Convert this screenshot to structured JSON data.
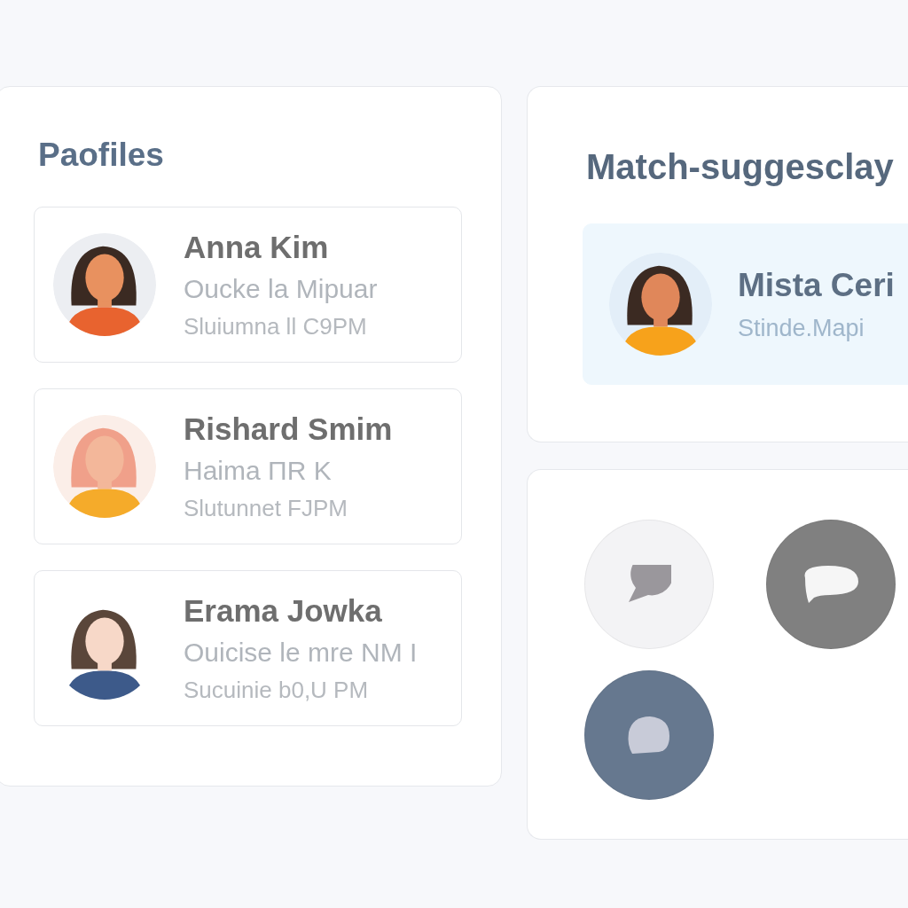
{
  "profiles": {
    "title": "Paofiles",
    "items": [
      {
        "name": "Anna Kim",
        "line_2": "Oucke la Mipuar",
        "line_3": "Sluiumna ll C9PM"
      },
      {
        "name": "Rishard Smim",
        "line_2": "Haima ΠR K",
        "line_3": "Slutunnet FJPM"
      },
      {
        "name": "Erama Jowka",
        "line_2": "Ouicise le mre NM I",
        "line_3": "Sucuinie b0,U PM"
      }
    ]
  },
  "match_suggestions": {
    "title": "Match-suggesclay",
    "items": [
      {
        "name": "Mista Ceri",
        "subtitle": "Stinde.Mapi",
        "selected": true
      }
    ]
  },
  "chat_buttons": [
    {
      "kind": "round",
      "color": "#f3f3f5"
    },
    {
      "kind": "oval",
      "color": "#808080"
    },
    {
      "kind": "plain",
      "color": "#66788f"
    }
  ]
}
